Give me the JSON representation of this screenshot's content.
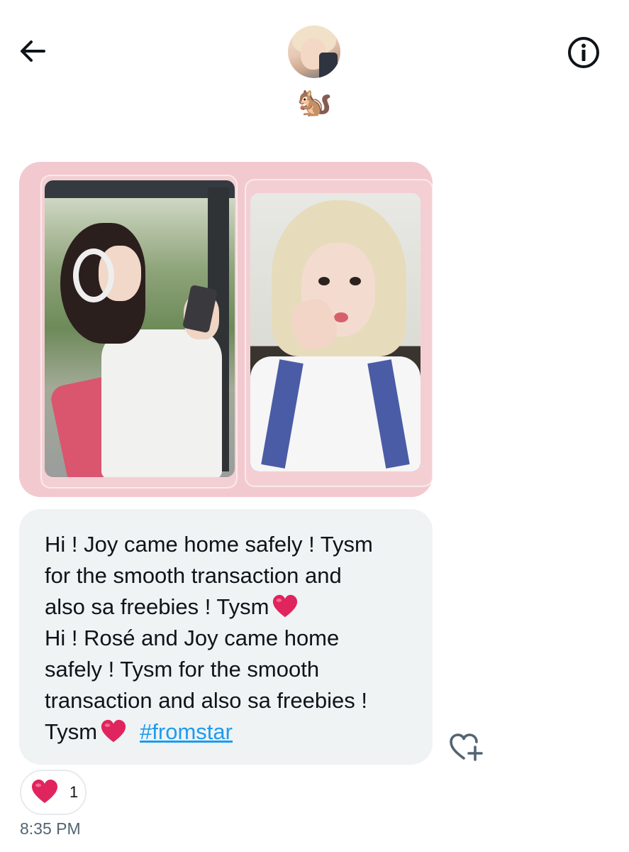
{
  "header": {
    "display_name": "🐿️",
    "back_icon": "arrow-left-icon",
    "info_icon": "info-circle-icon"
  },
  "media": {
    "description_icon": "photo-image"
  },
  "message": {
    "lines": [
      "Hi !  Joy came home safely ! Tysm",
      "for the smooth transaction and",
      "also sa freebies ! Tysm",
      "Hi ! Rosé and Joy came home",
      "safely ! Tysm for the smooth",
      "transaction and also sa freebies !",
      "Tysm"
    ],
    "hashtag": "#fromstar",
    "react_icon": "heart-plus-icon"
  },
  "reaction": {
    "emoji_icon": "red-heart-icon",
    "count": "1"
  },
  "timestamp": "8:35 PM",
  "colors": {
    "accent": "#1d9bf0",
    "bubble": "#eff3f4",
    "heart": "#e0245e",
    "muted_text": "#536471",
    "media_background": "#f2c9cf"
  }
}
